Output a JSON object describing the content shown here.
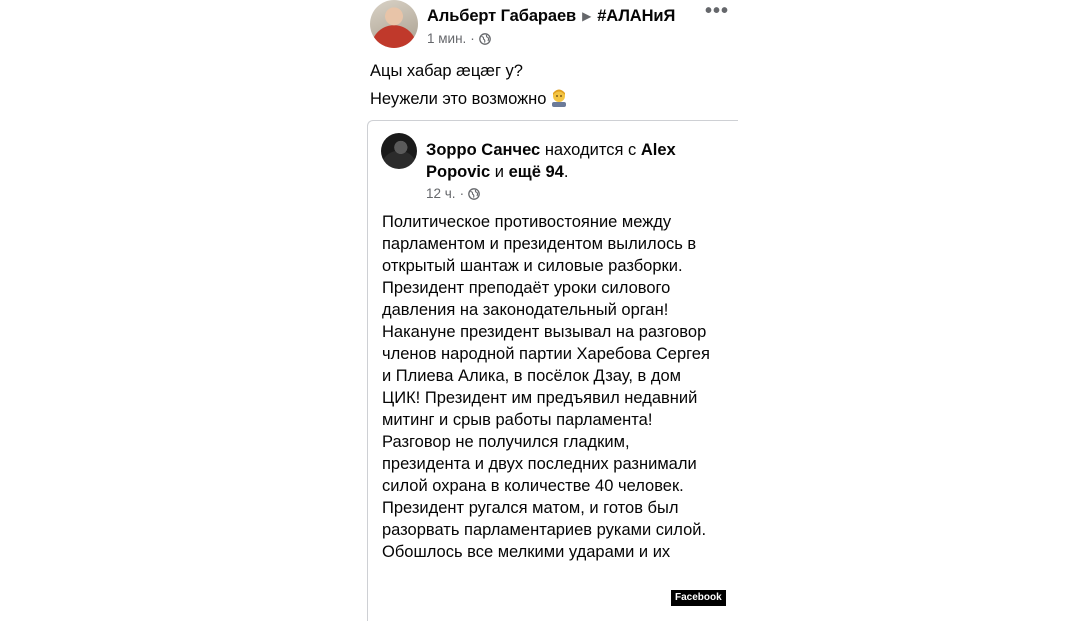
{
  "post": {
    "author": "Альберт Габараев",
    "group": "#АЛАНиЯ",
    "time": "1 мин.",
    "dot": "·",
    "more": "•••",
    "text_line1": "Ацы хабар æцæг у?",
    "text_line2": "Неужели это возможно",
    "emoji": "man-emoji"
  },
  "shared": {
    "author": "Зорро Санчес",
    "with_text": "находится с",
    "tagged": "Alex Popovic",
    "and_text": "и",
    "others": "ещё 94",
    "period": ".",
    "time": "12 ч.",
    "dot": "·",
    "body": "Политическое противостояние между парламентом и президентом вылилось в открытый шантаж и силовые разборки. Президент преподаёт уроки силового давления на законодательный орган!\n Накануне президент вызывал на разговор членов народной партии Харебова Сергея и Плиева Алика, в посёлок Дзау, в дом ЦИК! Президент им предъявил недавний митинг и срыв работы парламента! Разговор не получился гладким, президента и двух последних разнимали силой охрана в количестве 40 человек. Президент ругался матом, и готов был разорвать парламентариев руками силой. Обошлось все мелкими ударами и их"
  },
  "watermark": "Facebook",
  "colors": {
    "text": "#050505",
    "meta": "#65676b",
    "border": "#ced0d4"
  }
}
